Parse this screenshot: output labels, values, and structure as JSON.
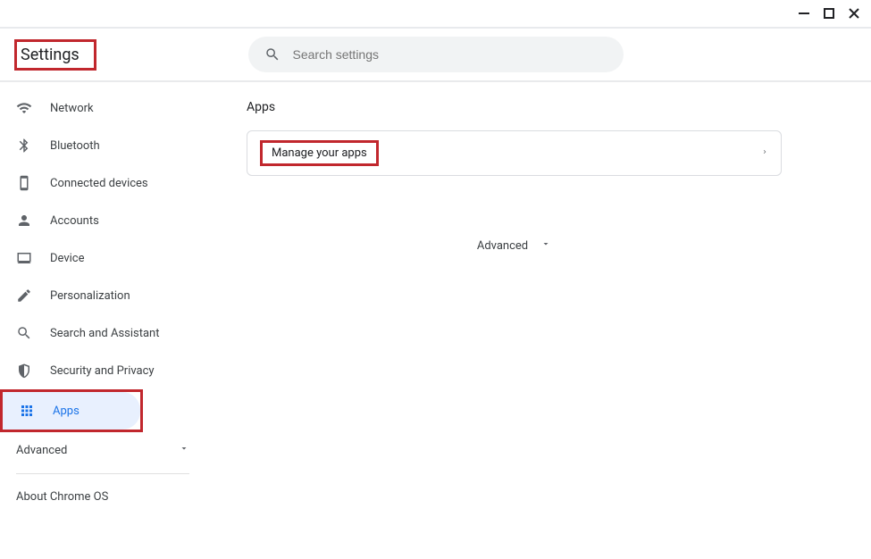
{
  "window": {
    "title": "Settings"
  },
  "search": {
    "placeholder": "Search settings"
  },
  "sidebar": {
    "items": [
      {
        "label": "Network"
      },
      {
        "label": "Bluetooth"
      },
      {
        "label": "Connected devices"
      },
      {
        "label": "Accounts"
      },
      {
        "label": "Device"
      },
      {
        "label": "Personalization"
      },
      {
        "label": "Search and Assistant"
      },
      {
        "label": "Security and Privacy"
      },
      {
        "label": "Apps"
      }
    ],
    "advanced": "Advanced",
    "about": "About Chrome OS"
  },
  "main": {
    "section_title": "Apps",
    "manage_apps": "Manage your apps",
    "advanced": "Advanced"
  },
  "colors": {
    "accent": "#1a73e8",
    "highlight": "#c1272d"
  }
}
